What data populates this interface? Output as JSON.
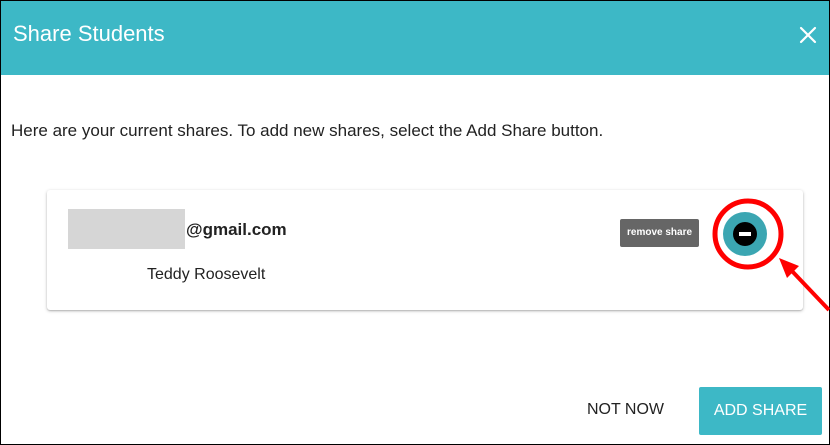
{
  "dialog": {
    "title": "Share Students",
    "close_icon": "close-icon",
    "intro_text": "Here are your current shares. To add new shares, select the Add Share button."
  },
  "shares": [
    {
      "email": "@gmail.com",
      "student": "Teddy Roosevelt",
      "tooltip": "remove share",
      "remove_icon": "minus-circle-icon"
    }
  ],
  "actions": {
    "not_now_label": "NOT NOW",
    "add_share_label": "ADD SHARE"
  },
  "colors": {
    "header": "#3db8c6",
    "primary_button": "#3db8c6",
    "remove_button": "#3ba6b2",
    "tooltip": "#666666",
    "annotation": "#ff0000"
  }
}
